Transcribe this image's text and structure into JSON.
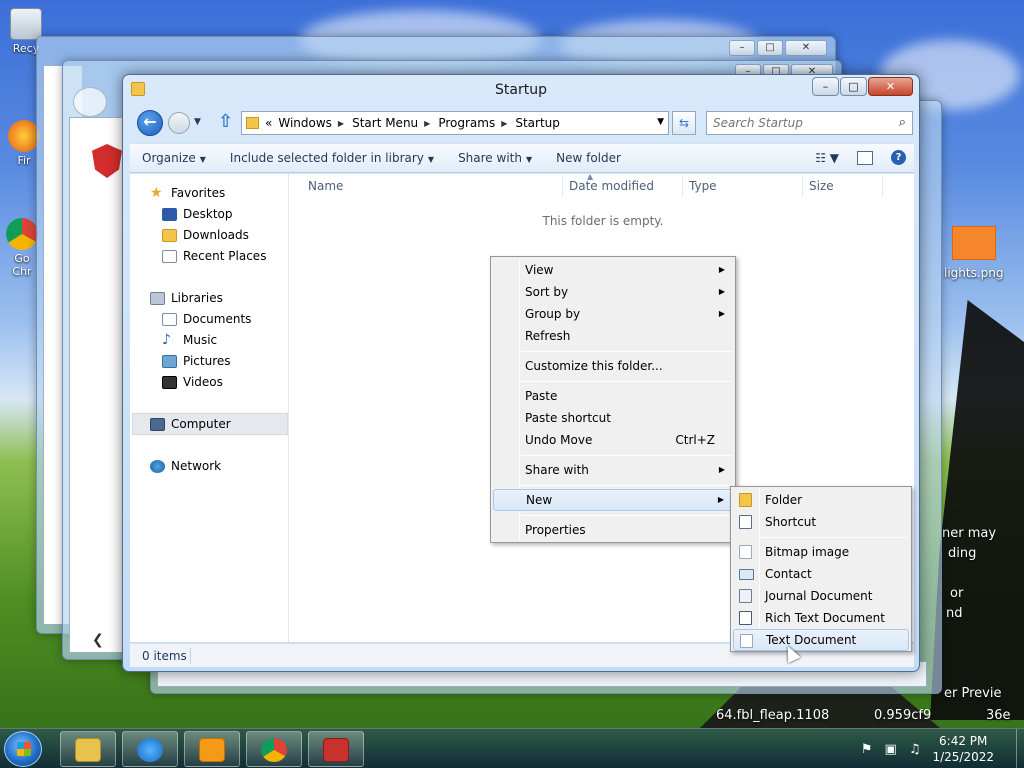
{
  "desktop": {
    "icons": [
      {
        "label": "Recy",
        "icon": "recycle-bin-icon"
      },
      {
        "label": "Fir",
        "icon": "firefox-icon"
      },
      {
        "label": "Go Chr",
        "icon": "chrome-icon"
      }
    ],
    "file_label": "lights.png",
    "partial_texts": [
      "ner may",
      "ding",
      "or",
      "nd",
      "er Previe",
      "64.fbl_fleap.1108",
      "0.959cf9",
      "36e"
    ]
  },
  "window": {
    "title": "Startup",
    "caption": {
      "minimize": "–",
      "maximize": "□",
      "close": "✕"
    },
    "address": {
      "overflow": "«",
      "crumbs": [
        "Windows",
        "Start Menu",
        "Programs",
        "Startup"
      ]
    },
    "search_placeholder": "Search Startup",
    "command_bar": {
      "organize": "Organize",
      "include": "Include selected folder in library",
      "share": "Share with",
      "new_folder": "New folder"
    },
    "nav": {
      "favorites": "Favorites",
      "desktop": "Desktop",
      "downloads": "Downloads",
      "recent": "Recent Places",
      "libraries": "Libraries",
      "documents": "Documents",
      "music": "Music",
      "pictures": "Pictures",
      "videos": "Videos",
      "computer": "Computer",
      "network": "Network"
    },
    "columns": [
      "Name",
      "Date modified",
      "Type",
      "Size"
    ],
    "empty_message": "This folder is empty.",
    "status": "0 items"
  },
  "context_menu": {
    "view": "View",
    "sort_by": "Sort by",
    "group_by": "Group by",
    "refresh": "Refresh",
    "customize": "Customize this folder...",
    "paste": "Paste",
    "paste_shortcut": "Paste shortcut",
    "undo_move": "Undo Move",
    "undo_accel": "Ctrl+Z",
    "share_with": "Share with",
    "new": "New",
    "properties": "Properties"
  },
  "new_submenu": {
    "folder": "Folder",
    "shortcut": "Shortcut",
    "bitmap": "Bitmap image",
    "contact": "Contact",
    "journal": "Journal Document",
    "rtf": "Rich Text Document",
    "text": "Text Document"
  },
  "taskbar": {
    "time": "6:42 PM",
    "date": "1/25/2022"
  }
}
